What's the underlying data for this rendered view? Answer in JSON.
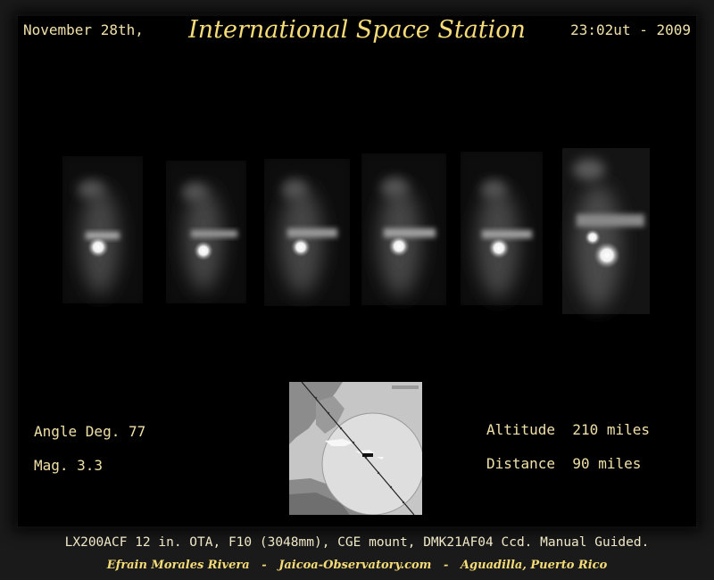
{
  "header": {
    "date_left": "November 28th,",
    "title": "International Space Station",
    "date_right": "23:02ut - 2009"
  },
  "stats": {
    "angle": "Angle Deg. 77",
    "mag": "Mag. 3.3",
    "altitude": "Altitude  210 miles",
    "distance": "Distance  90 miles"
  },
  "footer": {
    "equipment": "LX200ACF 12 in. OTA, F10 (3048mm), CGE mount, DMK21AF04 Ccd. Manual Guided.",
    "credits": "Efrain Morales Rivera   -   Jaicoa-Observatory.com   -   Aguadilla, Puerto Rico"
  },
  "colors": {
    "title": "#f5dc78",
    "text": "#f0e0a8",
    "background": "#000000"
  }
}
